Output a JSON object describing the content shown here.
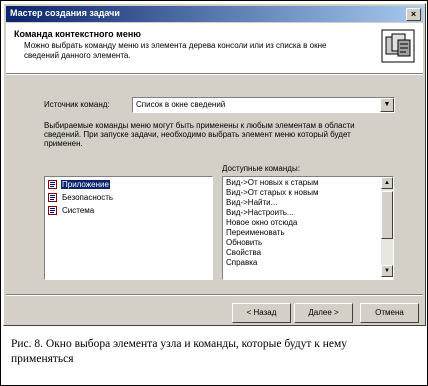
{
  "window": {
    "title": "Мастер создания задачи",
    "close_label": "×"
  },
  "header": {
    "title": "Команда контекстного меню",
    "description": "Можно выбрать команду меню из элемента дерева консоли или из списка в окне сведений данного элемента."
  },
  "source": {
    "label": "Источник команд:",
    "value": "Список в окне сведений"
  },
  "info_text": "Выбираемые команды меню могут быть применены к любым элементам в области сведений. При запуске задачи, необходимо выбрать элемент меню который будет применен.",
  "tree": {
    "items": [
      {
        "label": "Приложение",
        "selected": true
      },
      {
        "label": "Безопасность",
        "selected": false
      },
      {
        "label": "Система",
        "selected": false
      }
    ]
  },
  "commands": {
    "label": "Доступные команды:",
    "items": [
      "Вид->От новых к старым",
      "Вид->От старых к новым",
      "Вид->Найти...",
      "Вид->Настроить...",
      "Новое окно отсюда",
      "Переименовать",
      "Обновить",
      "Свойства",
      "Справка"
    ]
  },
  "buttons": {
    "back": "< Назад",
    "next": "Далее >",
    "cancel": "Отмена"
  },
  "caption": "Рис. 8. Окно выбора элемента узла и команды, которые будут к нему применяться",
  "colors": {
    "titlebar_start": "#0a246a",
    "titlebar_end": "#a6caf0",
    "dialog_face": "#d4d0c8",
    "selection": "#0a246a"
  }
}
